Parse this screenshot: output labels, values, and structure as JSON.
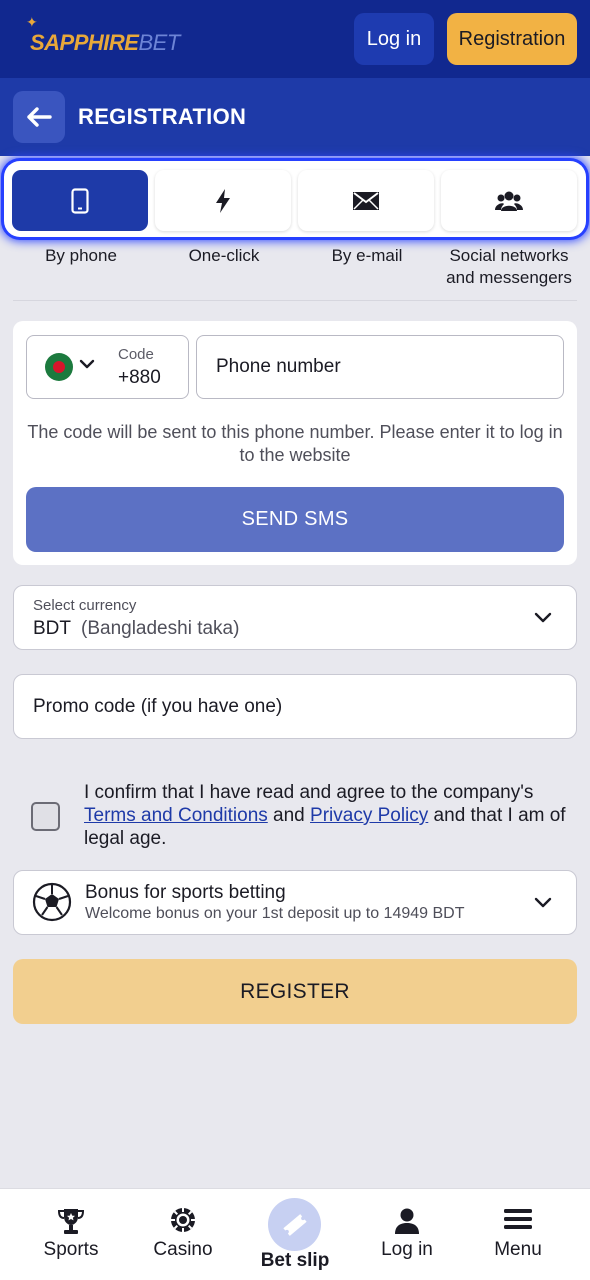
{
  "header": {
    "logo_main": "SAPPHIRE",
    "logo_accent": "BET",
    "login_label": "Log in",
    "registration_label": "Registration"
  },
  "subheader": {
    "back_icon": "arrow-left-icon",
    "title": "REGISTRATION"
  },
  "methods": [
    {
      "label": "By phone",
      "icon": "smartphone-icon",
      "active": true
    },
    {
      "label": "One-click",
      "icon": "lightning-icon",
      "active": false
    },
    {
      "label": "By e-mail",
      "icon": "envelope-icon",
      "active": false
    },
    {
      "label": "Social networks\nand messengers",
      "icon": "users-icon",
      "active": false
    }
  ],
  "phone_form": {
    "code_label": "Code",
    "code_value": "+880",
    "phone_placeholder": "Phone number",
    "hint": "The code will be sent to this phone number. Please enter it to log in to the website",
    "send_sms_label": "SEND SMS"
  },
  "currency": {
    "label": "Select currency",
    "code": "BDT",
    "name": "(Bangladeshi taka)"
  },
  "promo": {
    "placeholder": "Promo code (if you have one)"
  },
  "consent": {
    "text_before": "I confirm that I have read and agree to the company's ",
    "terms_link": "Terms and Conditions",
    "text_middle": " and ",
    "privacy_link": "Privacy Policy",
    "text_after": " and that I am of legal age.",
    "checked": false
  },
  "bonus": {
    "title": "Bonus for sports betting",
    "subtitle": "Welcome bonus on your 1st deposit up to 14949 BDT"
  },
  "register_label": "REGISTER",
  "bottom_nav": [
    {
      "label": "Sports",
      "icon": "trophy-icon"
    },
    {
      "label": "Casino",
      "icon": "casino-chip-icon"
    },
    {
      "label": "Bet slip",
      "icon": "ticket-icon"
    },
    {
      "label": "Log in",
      "icon": "user-icon"
    },
    {
      "label": "Menu",
      "icon": "hamburger-menu-icon"
    }
  ],
  "colors": {
    "primary": "#1e3aa8",
    "header": "#11288f",
    "accent": "#f2b244",
    "sms_button": "#5c71c4",
    "register_button": "#f2cf8f"
  }
}
